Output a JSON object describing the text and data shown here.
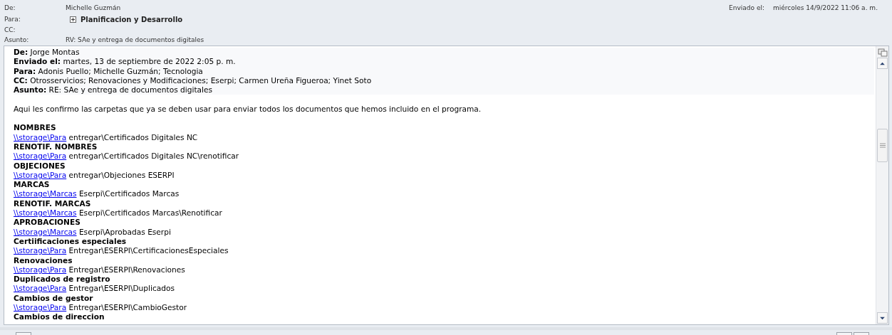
{
  "header": {
    "from": {
      "label": "De:",
      "value": "Michelle Guzmán"
    },
    "to": {
      "label": "Para:",
      "value": "Planificacion y Desarrollo"
    },
    "cc": {
      "label": "CC:"
    },
    "subject": {
      "label": "Asunto:",
      "value": "RV: SAe y entrega de documentos digitales"
    },
    "sent": {
      "label": "Enviado el:",
      "value": "miércoles 14/9/2022 11:06 a. m."
    }
  },
  "quoted_header": [
    {
      "label": "De:",
      "value": "Jorge Montas"
    },
    {
      "label": "Enviado el:",
      "value": "martes, 13 de septiembre de 2022 2:05 p. m."
    },
    {
      "label": "Para:",
      "value": "Adonis Puello; Michelle Guzmán; Tecnologia"
    },
    {
      "label": "CC:",
      "value": "Otrosservicios; Renovaciones y Modificaciones; Eserpi; Carmen Ureña Figueroa; Yinet Soto"
    },
    {
      "label": "Asunto:",
      "value": "RE: SAe y entrega de documentos digitales"
    }
  ],
  "message": "Aqui les confirmo las carpetas que ya se deben usar para enviar todos los documentos que hemos incluido en el programa.",
  "folders": [
    {
      "heading": "NOMBRES",
      "link": "\\\\storage\\Para",
      "path": "entregar\\Certificados Digitales NC"
    },
    {
      "heading": "RENOTIF. NOMBRES",
      "link": "\\\\storage\\Para",
      "path": "entregar\\Certificados Digitales NC\\renotificar"
    },
    {
      "heading": "OBJECIONES",
      "link": "\\\\storage\\Para",
      "path": "entregar\\Objeciones ESERPI"
    },
    {
      "heading": "MARCAS",
      "link": "\\\\storage\\Marcas",
      "path": "Eserpi\\Certificados Marcas"
    },
    {
      "heading": "RENOTIF. MARCAS",
      "link": "\\\\storage\\Marcas",
      "path": "Eserpi\\Certificados Marcas\\Renotificar"
    },
    {
      "heading": "APROBACIONES",
      "link": "\\\\storage\\Marcas",
      "path": "Eserpi\\Aprobadas Eserpi"
    },
    {
      "heading": "Certiificaciones especiales",
      "link": "\\\\storage\\Para",
      "path": "Entregar\\ESERPI\\CertificacionesEspeciales"
    },
    {
      "heading": "Renovaciones",
      "link": "\\\\storage\\Para",
      "path": "Entregar\\ESERPI\\Renovaciones"
    },
    {
      "heading": "Duplicados de registro",
      "link": "\\\\storage\\Para",
      "path": "Entregar\\ESERPI\\Duplicados"
    },
    {
      "heading": "Cambios de gestor",
      "link": "\\\\storage\\Para",
      "path": "Entregar\\ESERPI\\CambioGestor"
    },
    {
      "heading": "Cambios de direccion"
    }
  ]
}
